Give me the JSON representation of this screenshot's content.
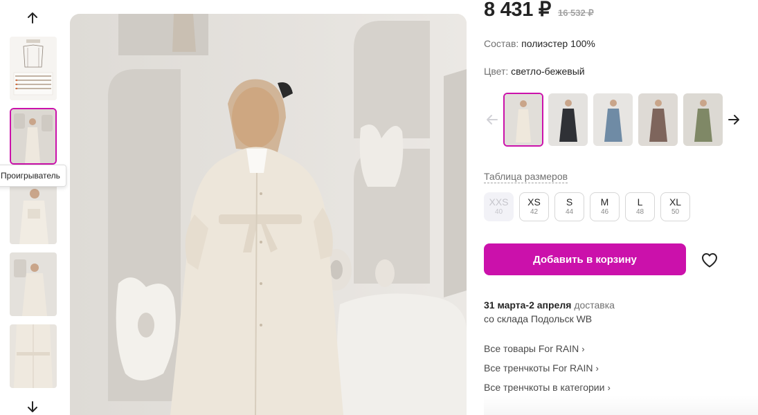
{
  "thumbnails": {
    "up_icon": "arrow-up-icon",
    "down_icon": "arrow-down-icon",
    "tooltip": "Проигрыватель"
  },
  "product": {
    "price": "8 431 ₽",
    "old_price": "16 532 ₽",
    "composition_label": "Состав:",
    "composition_value": "полиэстер 100%",
    "color_label": "Цвет:",
    "color_value": "светло-бежевый"
  },
  "colors": {
    "swatches": [
      "светло-бежевый",
      "чёрный",
      "голубой",
      "коричневый",
      "хаки"
    ]
  },
  "sizes": {
    "table_link": "Таблица размеров",
    "items": [
      {
        "label": "XXS",
        "ru": "40",
        "available": false
      },
      {
        "label": "XS",
        "ru": "42",
        "available": true
      },
      {
        "label": "S",
        "ru": "44",
        "available": true
      },
      {
        "label": "M",
        "ru": "46",
        "available": true
      },
      {
        "label": "L",
        "ru": "48",
        "available": true
      },
      {
        "label": "XL",
        "ru": "50",
        "available": true
      }
    ]
  },
  "cart": {
    "button_label": "Добавить в корзину",
    "accent_color": "#cb11ab"
  },
  "delivery": {
    "dates": "31 марта-2 апреля",
    "word": "доставка",
    "from": "со склада Подольск WB"
  },
  "links": [
    "Все товары For RAIN",
    "Все тренчкоты For RAIN",
    "Все тренчкоты в категории"
  ]
}
